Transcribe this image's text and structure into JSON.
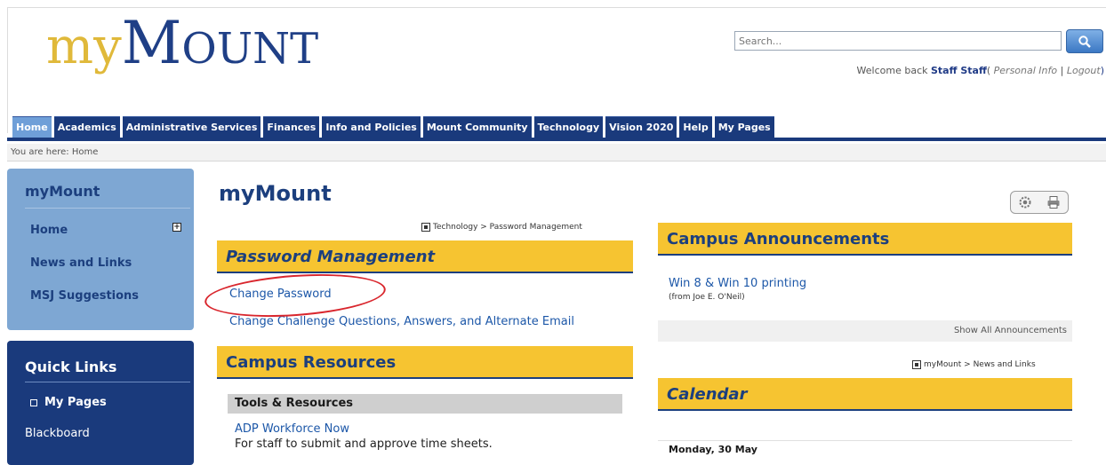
{
  "header": {
    "logo": {
      "my": "my",
      "mount_initial": "M",
      "mount_rest": "OUNT"
    },
    "search": {
      "placeholder": "Search..."
    },
    "welcome": {
      "prefix": "Welcome back",
      "user_name": "Staff Staff",
      "open_paren": "(",
      "personal_info": "Personal Info",
      "separator": "|",
      "logout": "Logout",
      "close_paren": ")"
    }
  },
  "nav": {
    "tabs": [
      {
        "label": "Home",
        "active": true
      },
      {
        "label": "Academics"
      },
      {
        "label": "Administrative Services"
      },
      {
        "label": "Finances"
      },
      {
        "label": "Info and Policies"
      },
      {
        "label": "Mount Community"
      },
      {
        "label": "Technology"
      },
      {
        "label": "Vision 2020"
      },
      {
        "label": "Help"
      },
      {
        "label": "My Pages"
      }
    ]
  },
  "breadcrumb": {
    "text": "You are here:  Home"
  },
  "sidebar": {
    "title": "myMount",
    "items": [
      {
        "label": "Home"
      },
      {
        "label": "News and Links"
      },
      {
        "label": "MSJ Suggestions"
      }
    ],
    "quick_links": {
      "title": "Quick Links",
      "items": [
        {
          "label": "My Pages"
        },
        {
          "label": "Blackboard"
        }
      ]
    }
  },
  "main": {
    "page_title": "myMount",
    "password_portlet": {
      "crumb": "Technology > Password Management",
      "title": "Password Management",
      "links": [
        {
          "label": "Change Password"
        },
        {
          "label": "Change Challenge Questions, Answers, and Alternate Email"
        }
      ]
    },
    "resources_portlet": {
      "title": "Campus Resources",
      "section_header": "Tools & Resources",
      "item_title": "ADP Workforce Now",
      "item_desc": "For staff to submit and approve time sheets."
    },
    "announcements_portlet": {
      "title": "Campus Announcements",
      "item_title": "Win 8 & Win 10 printing",
      "item_from": "(from Joe E. O'Neil)",
      "show_all": "Show All Announcements"
    },
    "calendar_portlet": {
      "crumb": "myMount > News and Links",
      "title": "Calendar",
      "day": "Monday, 30 May"
    }
  },
  "colors": {
    "navy": "#1a3a7c",
    "sidebar_blue": "#7ea7d3",
    "gold": "#f6c431",
    "annotation_red": "#d9262d"
  }
}
